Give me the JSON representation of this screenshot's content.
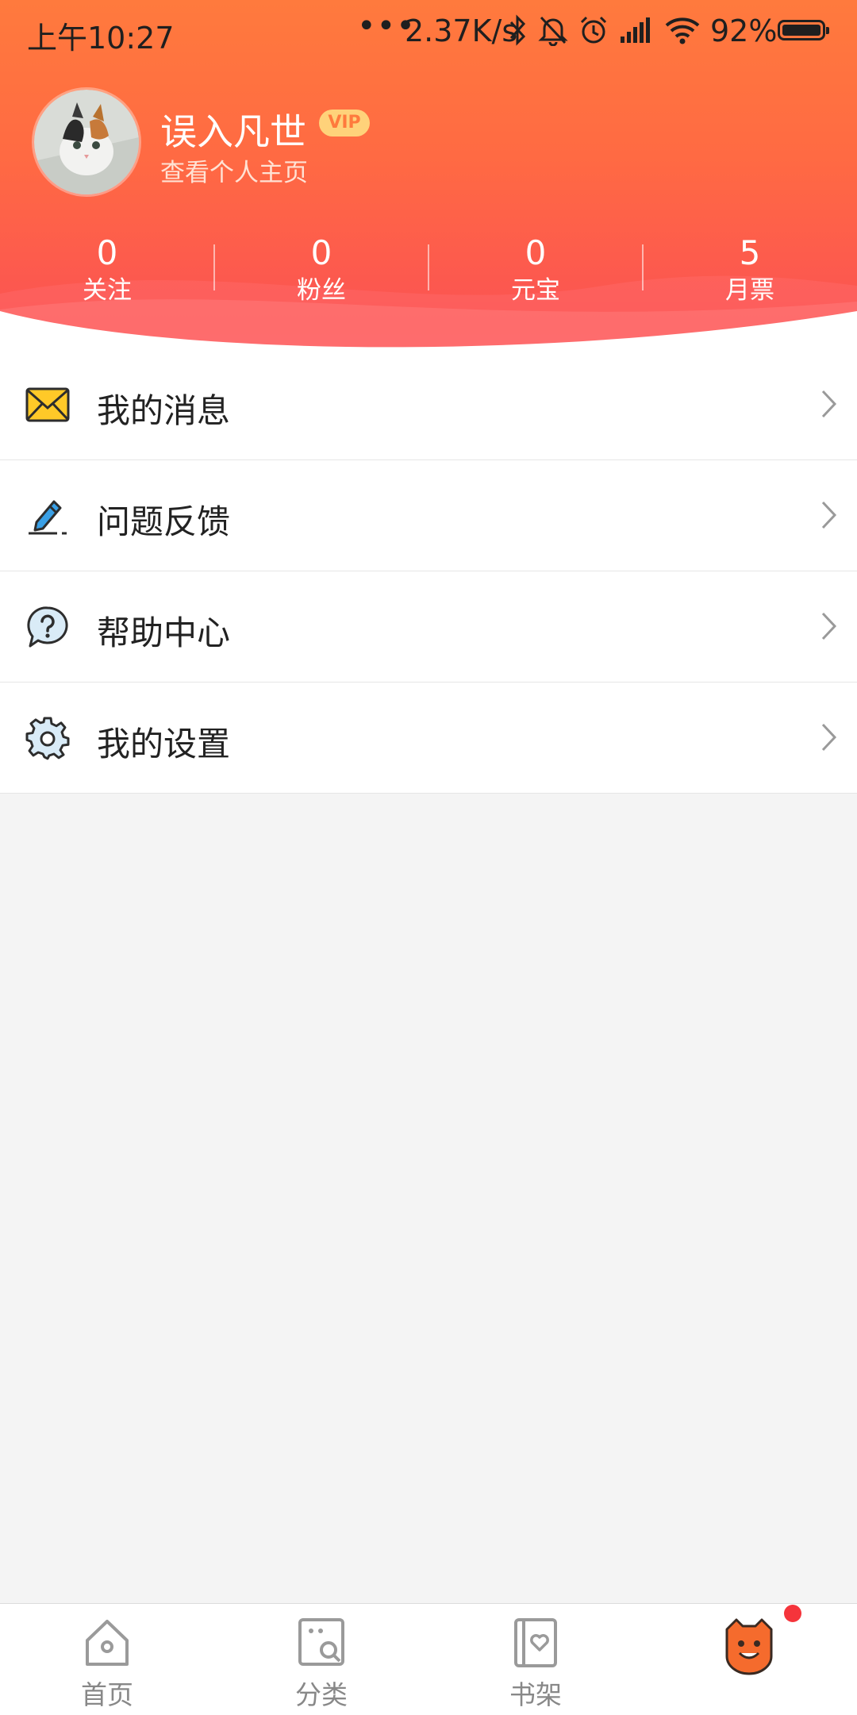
{
  "status_bar": {
    "time": "上午10:27",
    "dots": "•••",
    "net_speed": "2.37K/s",
    "battery": "92%"
  },
  "profile": {
    "username": "误入凡世",
    "vip_label": "VIP",
    "profile_link": "查看个人主页"
  },
  "stats": [
    {
      "value": "0",
      "label": "关注"
    },
    {
      "value": "0",
      "label": "粉丝"
    },
    {
      "value": "0",
      "label": "元宝"
    },
    {
      "value": "5",
      "label": "月票"
    }
  ],
  "menu": [
    {
      "label": "我的消息",
      "icon": "envelope-icon"
    },
    {
      "label": "问题反馈",
      "icon": "pencil-icon"
    },
    {
      "label": "帮助中心",
      "icon": "help-bubble-icon"
    },
    {
      "label": "我的设置",
      "icon": "gear-icon"
    }
  ],
  "nav": [
    {
      "label": "首页",
      "icon": "home-icon"
    },
    {
      "label": "分类",
      "icon": "category-icon"
    },
    {
      "label": "书架",
      "icon": "bookshelf-icon"
    },
    {
      "label": "",
      "icon": "mascot-face-icon"
    }
  ],
  "colors": {
    "header_top": "#ff7a3d",
    "header_bottom": "#fb4f55",
    "vip_badge": "#ffd27a",
    "notification_dot": "#f5343b"
  }
}
